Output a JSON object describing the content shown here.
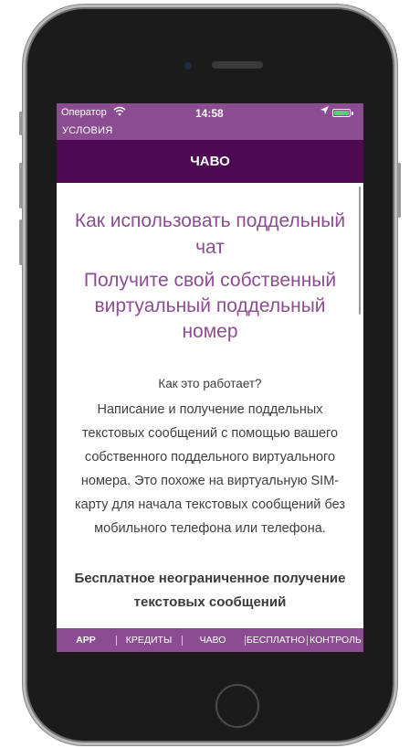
{
  "status_bar": {
    "carrier": "Оператор",
    "wifi_icon": "wifi-icon",
    "time": "14:58",
    "location_icon": "location-arrow-icon",
    "battery_icon": "battery-icon"
  },
  "nav": {
    "back_label": "УСЛОВИЯ",
    "title": "ЧАВО"
  },
  "content": {
    "heading_line1": "Как использовать поддельный",
    "heading_line2": "чат",
    "subheading": "Получите свой собственный виртуальный поддельный номер",
    "question": "Как это работает?",
    "paragraph": "Написание и получение поддельных текстовых сообщений с помощью вашего собственного поддельного виртуального номера. Это похоже на виртуальную SIM-карту для начала текстовых сообщений без мобильного телефона или телефона.",
    "bold_text": "Бесплатное неограниченное получение текстовых сообщений"
  },
  "tabs": [
    {
      "label": "APP",
      "active": true
    },
    {
      "label": "КРЕДИТЫ",
      "active": false
    },
    {
      "label": "ЧАВО",
      "active": false
    },
    {
      "label": "БЕСПЛАТНО",
      "active": false
    },
    {
      "label": "КОНТРОЛЬ",
      "active": false
    }
  ],
  "colors": {
    "accent": "#8c4c91",
    "title_bar": "#4d0a53",
    "heading_text": "#8d4d92",
    "battery": "#4cd964"
  }
}
